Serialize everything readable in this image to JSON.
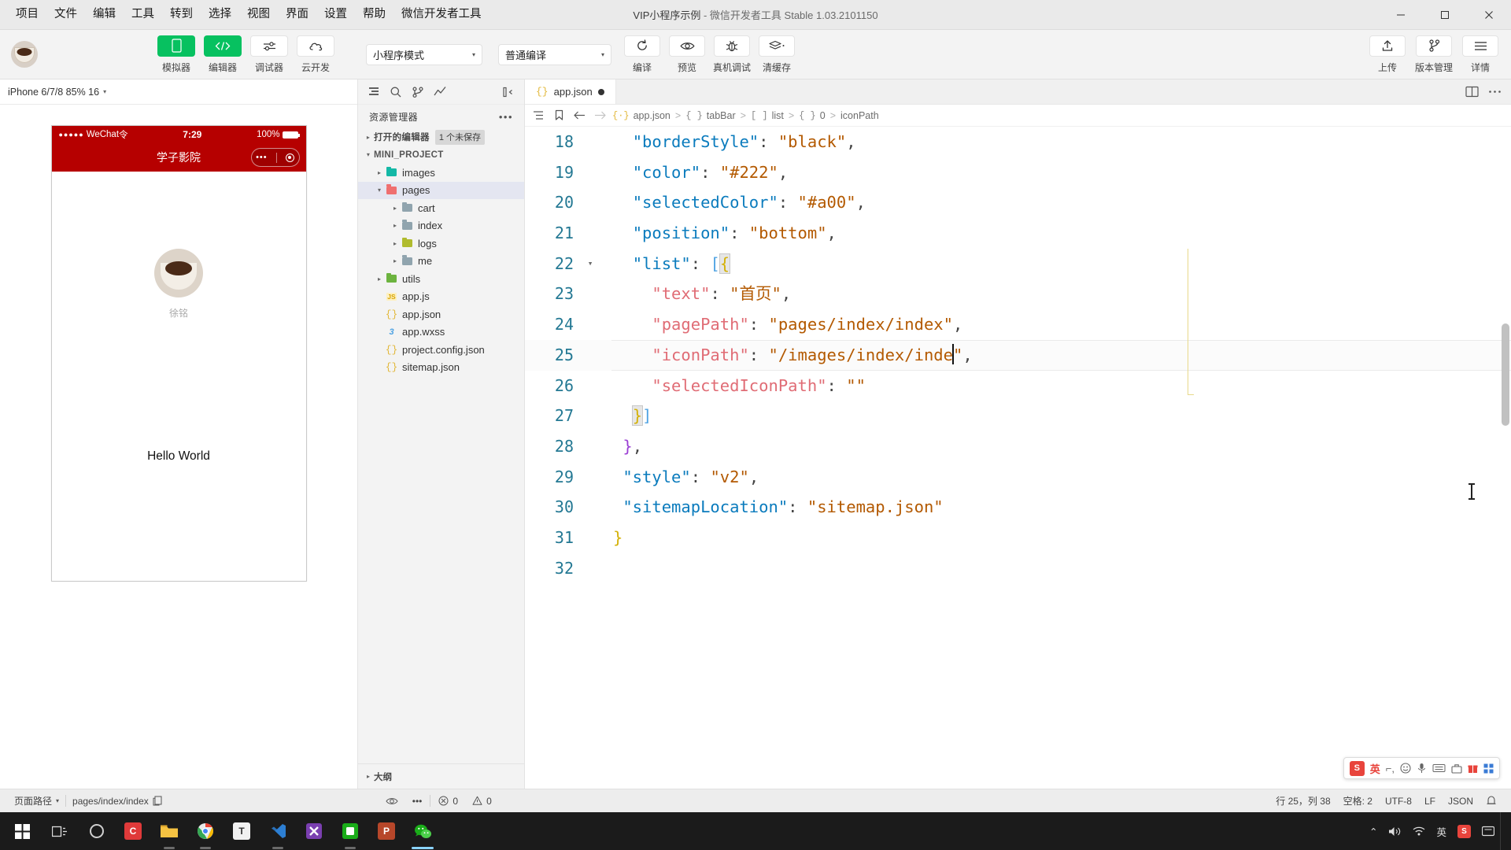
{
  "window": {
    "title_main": "VIP小程序示例",
    "title_sub": " - 微信开发者工具 Stable 1.03.2101150",
    "minimize": "—",
    "maximize": "▢",
    "close": "✕"
  },
  "menubar": {
    "items": [
      {
        "label": "项目"
      },
      {
        "label": "文件"
      },
      {
        "label": "编辑"
      },
      {
        "label": "工具"
      },
      {
        "label": "转到"
      },
      {
        "label": "选择"
      },
      {
        "label": "视图"
      },
      {
        "label": "界面"
      },
      {
        "label": "设置"
      },
      {
        "label": "帮助"
      },
      {
        "label": "微信开发者工具"
      }
    ]
  },
  "toolbar": {
    "toggles": [
      {
        "label": "模拟器",
        "icon": "phone-icon",
        "active": true
      },
      {
        "label": "编辑器",
        "icon": "code-icon",
        "active": true
      },
      {
        "label": "调试器",
        "icon": "sliders-icon",
        "active": false
      },
      {
        "label": "云开发",
        "icon": "cloud-icon",
        "active": false
      }
    ],
    "mode_select": {
      "value": "小程序模式",
      "caret": "▾"
    },
    "compile_select": {
      "value": "普通编译",
      "caret": "▾"
    },
    "actions": [
      {
        "label": "编译",
        "icon": "refresh-icon"
      },
      {
        "label": "预览",
        "icon": "eye-icon"
      },
      {
        "label": "真机调试",
        "icon": "bug-icon"
      },
      {
        "label": "清缓存",
        "icon": "layers-icon"
      }
    ],
    "right_actions": [
      {
        "label": "上传",
        "icon": "upload-icon"
      },
      {
        "label": "版本管理",
        "icon": "branch-icon"
      },
      {
        "label": "详情",
        "icon": "menu-icon"
      }
    ]
  },
  "simulator": {
    "device_label": "iPhone 6/7/8 85% 16",
    "device_caret": "▾",
    "tool_icons": [
      "phone-icon",
      "record-icon",
      "back-icon",
      "copy-icon"
    ],
    "phone": {
      "status": {
        "dots": "●●●●●",
        "carrier": "WeChat",
        "wifi": "令",
        "time": "7:29",
        "battery_text": "100%"
      },
      "nav_title": "学子影院",
      "capsule_more": "•••"
    },
    "profile_name": "徐铭",
    "hello": "Hello World"
  },
  "explorer": {
    "toolbar_icons": [
      "files-icon",
      "search-icon",
      "source-control-icon",
      "debug-icon",
      "collapse-icon"
    ],
    "title": "资源管理器",
    "more": "•••",
    "open_editors": {
      "label": "打开的编辑器",
      "badge": "1 个未保存",
      "arrow": "▸"
    },
    "project": {
      "label": "MINI_PROJECT",
      "arrow": "▾"
    },
    "tree": [
      {
        "label": "images",
        "arrow": "▸",
        "indent": 1,
        "type": "folder",
        "color": "f-teal",
        "selected": false
      },
      {
        "label": "pages",
        "arrow": "▾",
        "indent": 1,
        "type": "folder",
        "color": "f-red",
        "selected": true
      },
      {
        "label": "cart",
        "arrow": "▸",
        "indent": 2,
        "type": "folder",
        "color": "f-gray",
        "selected": false
      },
      {
        "label": "index",
        "arrow": "▸",
        "indent": 2,
        "type": "folder",
        "color": "f-gray",
        "selected": false
      },
      {
        "label": "logs",
        "arrow": "▸",
        "indent": 2,
        "type": "folder",
        "color": "f-olive",
        "selected": false
      },
      {
        "label": "me",
        "arrow": "▸",
        "indent": 2,
        "type": "folder",
        "color": "f-gray",
        "selected": false
      },
      {
        "label": "utils",
        "arrow": "▸",
        "indent": 1,
        "type": "folder",
        "color": "f-green",
        "selected": false
      },
      {
        "label": "app.js",
        "arrow": "",
        "indent": 1,
        "type": "js",
        "selected": false
      },
      {
        "label": "app.json",
        "arrow": "",
        "indent": 1,
        "type": "json",
        "selected": false
      },
      {
        "label": "app.wxss",
        "arrow": "",
        "indent": 1,
        "type": "wxss",
        "selected": false
      },
      {
        "label": "project.config.json",
        "arrow": "",
        "indent": 1,
        "type": "json",
        "selected": false
      },
      {
        "label": "sitemap.json",
        "arrow": "",
        "indent": 1,
        "type": "json",
        "selected": false
      }
    ],
    "outline": {
      "label": "大纲",
      "arrow": "▸"
    }
  },
  "editor": {
    "tab": {
      "name": "app.json",
      "icon": "json-icon",
      "dirty": true
    },
    "tab_actions": [
      "split-editor-icon",
      "more-icon"
    ],
    "breadcrumb_icons": [
      "outline-icon",
      "bookmark-icon",
      "back-arrow-icon",
      "forward-arrow-icon"
    ],
    "breadcrumb": [
      {
        "glyph": "{·}",
        "label": "app.json",
        "glyph_class": "gl"
      },
      {
        "glyph": "{ }",
        "label": "tabBar",
        "glyph_class": "gl br"
      },
      {
        "glyph": "[ ]",
        "label": "list",
        "glyph_class": "gl br"
      },
      {
        "glyph": "{ }",
        "label": "0",
        "glyph_class": "gl br"
      },
      {
        "glyph": "",
        "label": "iconPath",
        "glyph_class": "gl br"
      }
    ],
    "breadcrumb_sep": ">",
    "lines": [
      {
        "n": "18",
        "fold": "",
        "current": false,
        "html": "  <span class='k2'>\"borderStyle\"</span><span class='p'>:</span> <span class='s'>\"black\"</span><span class='p'>,</span>"
      },
      {
        "n": "19",
        "fold": "",
        "current": false,
        "html": "  <span class='k2'>\"color\"</span><span class='p'>:</span> <span class='s'>\"#222\"</span><span class='p'>,</span>"
      },
      {
        "n": "20",
        "fold": "",
        "current": false,
        "html": "  <span class='k2'>\"selectedColor\"</span><span class='p'>:</span> <span class='s'>\"#a00\"</span><span class='p'>,</span>"
      },
      {
        "n": "21",
        "fold": "",
        "current": false,
        "html": "  <span class='k2'>\"position\"</span><span class='p'>:</span> <span class='s'>\"bottom\"</span><span class='p'>,</span>"
      },
      {
        "n": "22",
        "fold": "▾",
        "current": false,
        "html": "  <span class='k2'>\"list\"</span><span class='p'>:</span> <span class='br-b'>[</span><span class='br-y hl-brace'>{</span>"
      },
      {
        "n": "23",
        "fold": "",
        "current": false,
        "html": "    <span class='k'>\"text\"</span><span class='p'>:</span> <span class='s'>\"首页\"</span><span class='p'>,</span>"
      },
      {
        "n": "24",
        "fold": "",
        "current": false,
        "html": "    <span class='k'>\"pagePath\"</span><span class='p'>:</span> <span class='s'>\"pages/index/index\"</span><span class='p'>,</span>"
      },
      {
        "n": "25",
        "fold": "",
        "current": true,
        "html": "    <span class='k'>\"iconPath\"</span><span class='p'>:</span> <span class='s'>\"/images/index/inde</span><span class='caret-bar'></span><span class='s'>\"</span><span class='p'>,</span>"
      },
      {
        "n": "26",
        "fold": "",
        "current": false,
        "html": "    <span class='k'>\"selectedIconPath\"</span><span class='p'>:</span> <span class='s'>\"\"</span>"
      },
      {
        "n": "27",
        "fold": "",
        "current": false,
        "html": "  <span class='br-y hl-brace'>}</span><span class='br-b'>]</span>"
      },
      {
        "n": "28",
        "fold": "",
        "current": false,
        "html": " <span class='br-p'>}</span><span class='p'>,</span>"
      },
      {
        "n": "29",
        "fold": "",
        "current": false,
        "html": " <span class='k2'>\"style\"</span><span class='p'>:</span> <span class='s'>\"v2\"</span><span class='p'>,</span>"
      },
      {
        "n": "30",
        "fold": "",
        "current": false,
        "html": " <span class='k2'>\"sitemapLocation\"</span><span class='p'>:</span> <span class='s'>\"sitemap.json\"</span>"
      },
      {
        "n": "31",
        "fold": "",
        "current": false,
        "html": "<span class='br-y'>}</span>"
      },
      {
        "n": "32",
        "fold": "",
        "current": false,
        "html": ""
      }
    ]
  },
  "ime": {
    "logo": "S",
    "lang": "英",
    "items": [
      "half-width-icon",
      "emoji-icon",
      "mic-icon",
      "keyboard-icon",
      "toolbox-icon",
      "gift-icon",
      "grid-icon"
    ]
  },
  "statusbar": {
    "page_path_label": "页面路径",
    "page_path_caret": "▾",
    "page_path_value": "pages/index/index",
    "copy_icon": "copy-icon",
    "eye_icon": "eye-icon",
    "more_icon": "•••",
    "errors": "0",
    "warnings": "0",
    "position": "行 25，列 38",
    "spaces": "空格: 2",
    "encoding": "UTF-8",
    "eol": "LF",
    "language": "JSON",
    "bell_icon": "bell-icon"
  },
  "taskbar": {
    "start": "start-icon",
    "task_view": "task-view-icon",
    "apps": [
      {
        "name": "cortana-icon",
        "label": "",
        "color": "transparent",
        "state": "none"
      },
      {
        "name": "app-c-icon",
        "label": "C",
        "color": "#e03a3a",
        "state": "none"
      },
      {
        "name": "file-explorer-icon",
        "label": "",
        "color": "#f4c430",
        "state": "run"
      },
      {
        "name": "chrome-icon",
        "label": "",
        "color": "transparent",
        "state": "run"
      },
      {
        "name": "app-t-icon",
        "label": "T",
        "color": "#f1f1f1",
        "state": "none"
      },
      {
        "name": "vscode-icon",
        "label": "",
        "color": "#2d7fd3",
        "state": "run"
      },
      {
        "name": "app-x-icon",
        "label": "",
        "color": "#7a3fb0",
        "state": "none"
      },
      {
        "name": "app-green-icon",
        "label": "",
        "color": "#1aad19",
        "state": "run"
      },
      {
        "name": "app-p-icon",
        "label": "P",
        "color": "#b7472a",
        "state": "none"
      },
      {
        "name": "wechat-devtools-icon",
        "label": "",
        "color": "#1aad19",
        "state": "active"
      }
    ],
    "tray": {
      "chevron": "⌃",
      "volume": "volume-icon",
      "network": "network-icon",
      "ime_lang": "英",
      "sogou": "S",
      "action_center": "action-center-icon"
    }
  }
}
